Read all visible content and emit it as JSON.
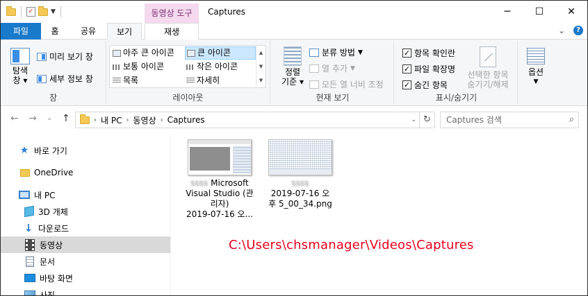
{
  "titlebar": {
    "context_tab": "동영상 도구",
    "window_title": "Captures",
    "minimize": "─",
    "maximize": "☐",
    "close": "✕"
  },
  "tabs": {
    "file": "파일",
    "home": "홈",
    "share": "공유",
    "view": "보기",
    "play": "재생",
    "collapse": "⌄",
    "help": "?"
  },
  "ribbon": {
    "pane_group": {
      "nav_pane_line1": "탐색",
      "nav_pane_line2": "창",
      "preview_pane": "미리 보기 창",
      "details_pane": "세부 정보 창",
      "label": "창"
    },
    "layout_group": {
      "extra_large_icons": "아주 큰 아이콘",
      "large_icons": "큰 아이콘",
      "medium_icons": "보통 아이콘",
      "small_icons": "작은 아이콘",
      "list": "목록",
      "details": "자세히",
      "label": "레이아웃"
    },
    "current_view_group": {
      "sort_by_line1": "정렬",
      "sort_by_line2": "기준",
      "group_by": "분류 방법",
      "add_columns": "열 추가",
      "size_columns": "모든 열 너비 조정",
      "label": "현재 보기"
    },
    "show_hide_group": {
      "item_checkboxes": "항목 확인란",
      "file_extensions": "파일 확장명",
      "hidden_items": "숨긴 항목",
      "hide_selected_line1": "선택한 항목",
      "hide_selected_line2": "숨기기/해제",
      "label": "표시/숨기기"
    },
    "options_group": {
      "options": "옵션"
    }
  },
  "address": {
    "back": "←",
    "forward": "→",
    "recent": "⌄",
    "up": "↑",
    "crumbs": [
      "내 PC",
      "동영상",
      "Captures"
    ],
    "search_placeholder": "Captures 검색"
  },
  "nav": {
    "quick_access": "바로 가기",
    "onedrive": "OneDrive",
    "this_pc": "내 PC",
    "objects_3d": "3D 개체",
    "downloads": "다운로드",
    "videos": "동영상",
    "documents": "문서",
    "desktop": "바탕 화면",
    "pictures": "사진"
  },
  "files": [
    {
      "name_blurred": "ssss",
      "name_line1": " Microsoft",
      "name_line2": "Visual Studio (관",
      "name_line3": "리자)",
      "date": "2019-07-16 오..."
    },
    {
      "name_blurred": "ssss",
      "date_line1": "2019-07-16 오",
      "date_line2": "후 5_00_34.png"
    }
  ],
  "overlay_path": "C:\\Users\\chsmanager\\Videos\\Captures"
}
